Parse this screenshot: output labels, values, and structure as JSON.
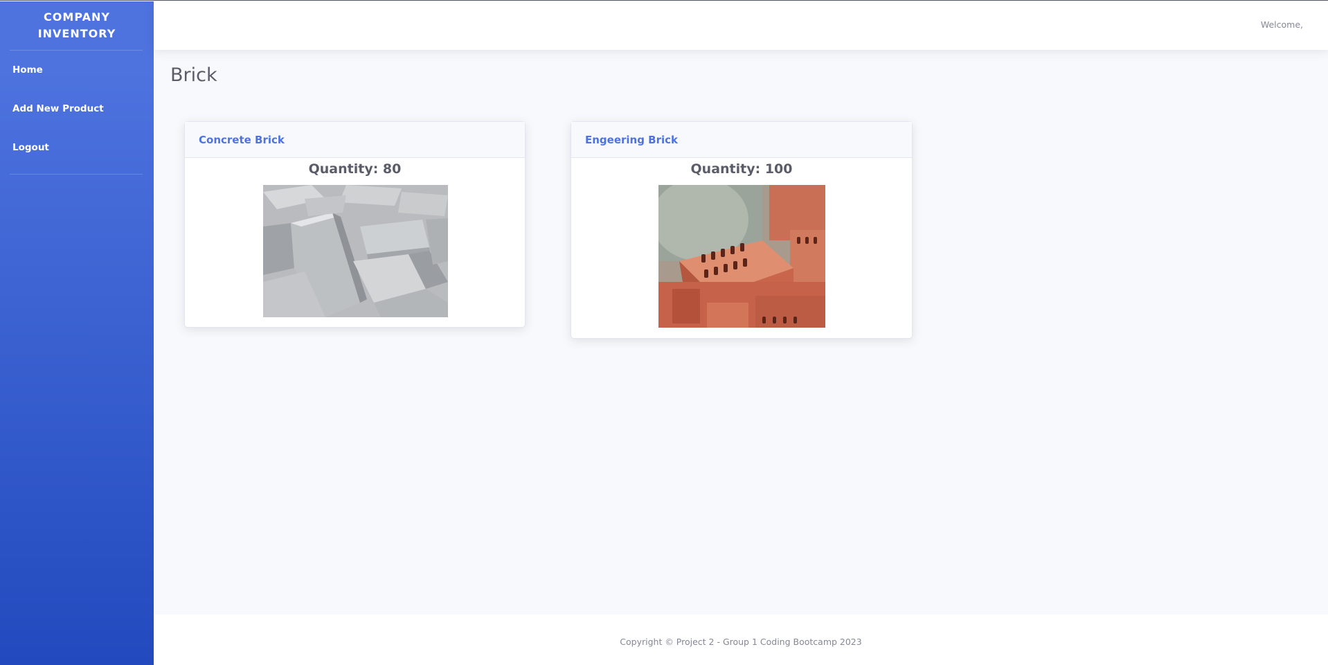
{
  "sidebar": {
    "brand": "COMPANY INVENTORY",
    "items": [
      {
        "label": "Home"
      },
      {
        "label": "Add New Product"
      },
      {
        "label": "Logout"
      }
    ]
  },
  "topbar": {
    "welcome": "Welcome,"
  },
  "page": {
    "title": "Brick"
  },
  "products": [
    {
      "name": "Concrete Brick",
      "quantity": "Quantity: 80"
    },
    {
      "name": "Engeering Brick",
      "quantity": "Quantity: 100"
    }
  ],
  "footer": {
    "text": "Copyright © Project 2 - Group 1 Coding Bootcamp 2023"
  },
  "colors": {
    "primary": "#4e73df",
    "primary_dark": "#224abe",
    "text": "#5a5c69",
    "muted": "#858796"
  }
}
